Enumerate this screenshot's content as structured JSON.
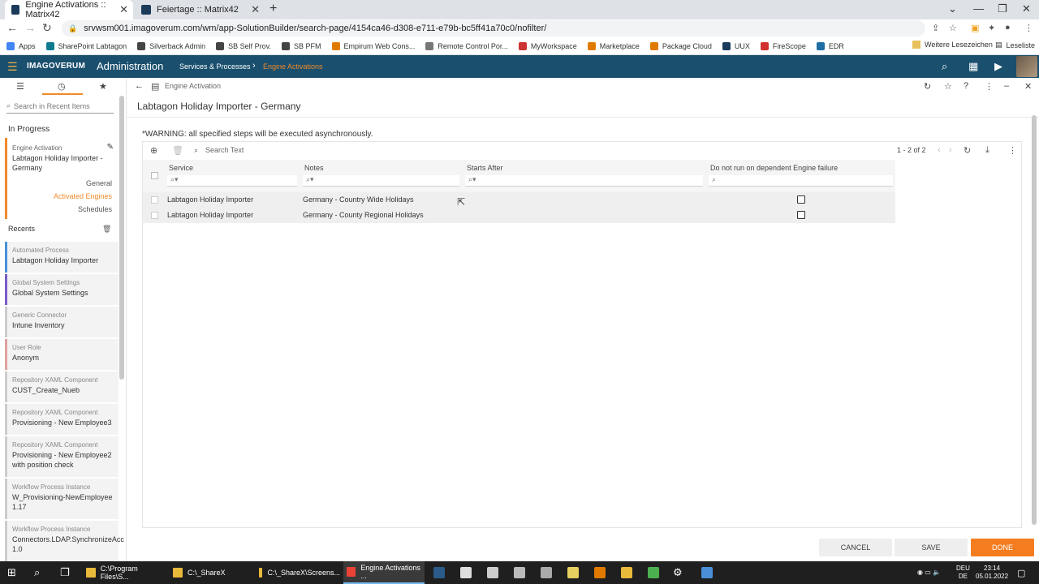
{
  "browser": {
    "tabs": [
      {
        "title": "Engine Activations :: Matrix42"
      },
      {
        "title": "Feiertage :: Matrix42"
      }
    ],
    "url": "srvwsm001.imagoverum.com/wm/app-SolutionBuilder/search-page/4154ca46-d308-e711-e79b-bc5ff41a70c0/nofilter/",
    "bookmarks": [
      "Apps",
      "SharePoint Labtagon",
      "Silverback Admin",
      "SB Self Prov.",
      "SB PFM",
      "Empirum Web Cons...",
      "Remote Control Por...",
      "MyWorkspace",
      "Marketplace",
      "Package Cloud",
      "UUX",
      "FireScope",
      "EDR"
    ],
    "bookmark_colors": [
      "#4285f4",
      "#0f7b8f",
      "#444444",
      "#444444",
      "#444444",
      "#e07b00",
      "#777777",
      "#cc3333",
      "#e07b00",
      "#e07b00",
      "#1c3b5a",
      "#d32f2f",
      "#1c6ea4"
    ],
    "bookmarks_right": [
      "Weitere Lesezeichen",
      "Leseliste"
    ]
  },
  "app": {
    "logo": "IMAGOVERUM",
    "title": "Administration",
    "crumb1": "Services & Processes",
    "crumb2": "Engine Activations",
    "accent": "#f08a2c",
    "header_bg": "#1a4f6e"
  },
  "left": {
    "search_placeholder": "Search in Recent Items",
    "in_progress_label": "In Progress",
    "in_progress": {
      "type": "Engine Activation",
      "name": "Labtagon Holiday Importer - Germany",
      "subnav": [
        "General",
        "Activated Engines",
        "Schedules"
      ]
    },
    "recents_label": "Recents",
    "recents": [
      {
        "type": "Automated Process",
        "name": "Labtagon Holiday Importer",
        "color": "#4a90d9"
      },
      {
        "type": "Global System Settings",
        "name": "Global System Settings",
        "color": "#7a5cc8"
      },
      {
        "type": "Generic Connector",
        "name": "Intune Inventory",
        "color": "#cccccc"
      },
      {
        "type": "User Role",
        "name": "Anonym",
        "color": "#e0a0a0"
      },
      {
        "type": "Repository XAML Component",
        "name": "CUST_Create_Nueb",
        "color": "#cccccc"
      },
      {
        "type": "Repository XAML Component",
        "name": "Provisioning - New Employee3",
        "color": "#cccccc"
      },
      {
        "type": "Repository XAML Component",
        "name": "Provisioning - New Employee2\nwith position check",
        "color": "#cccccc"
      },
      {
        "type": "Workflow Process Instance",
        "name": "W_Provisioning-NewEmployee\n1.17",
        "color": "#cccccc"
      },
      {
        "type": "Workflow Process Instance",
        "name": "Connectors.LDAP.SynchronizeAcc\n1.0",
        "color": "#cccccc"
      }
    ]
  },
  "main": {
    "breadcrumb": "Engine Activation",
    "title": "Labtagon Holiday Importer - Germany",
    "warning": "*WARNING: all specified steps will be executed asynchronously.",
    "search_placeholder": "Search Text",
    "count": "1 - 2 of 2",
    "columns": [
      "Service",
      "Notes",
      "Starts After",
      "Do not run on dependent Engine failure"
    ],
    "rows": [
      {
        "service": "Labtagon Holiday Importer",
        "notes": "Germany - Country Wide Holidays",
        "starts_after": "",
        "no_run": false
      },
      {
        "service": "Labtagon Holiday Importer",
        "notes": "Germany - County Regional Holidays",
        "starts_after": "",
        "no_run": false
      }
    ],
    "buttons": {
      "cancel": "CANCEL",
      "save": "SAVE",
      "done": "DONE"
    }
  },
  "taskbar": {
    "apps": [
      {
        "label": "C:\\Program Files\\S...",
        "color": "#e8b93a"
      },
      {
        "label": "C:\\_ShareX",
        "color": "#e8b93a"
      },
      {
        "label": "C:\\_ShareX\\Screens...",
        "color": "#e8b93a"
      },
      {
        "label": "Engine Activations ...",
        "color": "#ea4335"
      }
    ],
    "lang_top": "DEU",
    "lang_bottom": "DE",
    "time": "23:14",
    "date": "05.01.2022"
  }
}
